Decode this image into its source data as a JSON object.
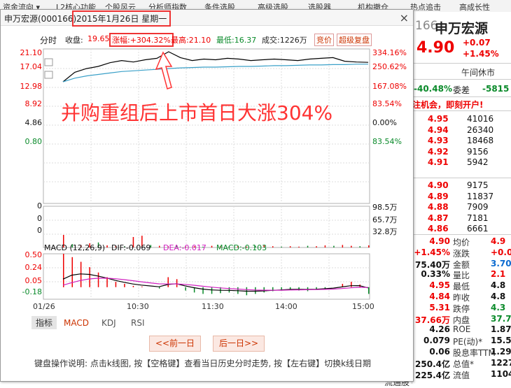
{
  "background_menu": [
    "资金流向 ▾",
    "L2核心功能",
    "个股风云",
    "分析师指数",
    "条件选股",
    "高级选股",
    "选股器",
    "机构撤仓",
    "热点追击",
    "高成长性"
  ],
  "quote_panel": {
    "code": "166",
    "name": "申万宏源",
    "price": "4.90",
    "change": "+0.07",
    "change_pct": "+1.45%",
    "status": "午间休市",
    "ratio_value": "-40.48%",
    "ratio_label": "委差",
    "diff_value": "-5815",
    "promo": "注机会，即刻开户!",
    "sell_levels": [
      [
        "4.95",
        "41016"
      ],
      [
        "4.94",
        "26340"
      ],
      [
        "4.93",
        "18468"
      ],
      [
        "4.92",
        "9156"
      ],
      [
        "4.91",
        "5942"
      ]
    ],
    "buy_levels": [
      [
        "4.90",
        "9175"
      ],
      [
        "4.89",
        "11837"
      ],
      [
        "4.88",
        "7909"
      ],
      [
        "4.87",
        "7181"
      ],
      [
        "4.86",
        "6661"
      ]
    ],
    "stats": [
      [
        "4.90",
        "均价",
        "4.9"
      ],
      [
        "+1.45%",
        "涨跌",
        "+0.0"
      ],
      [
        "75.40万",
        "金额",
        "3.70"
      ],
      [
        "0.33%",
        "量比",
        "2.1"
      ],
      [
        "4.95",
        "最低",
        "4.8"
      ],
      [
        "4.84",
        "昨收",
        "4.8"
      ],
      [
        "5.31",
        "跌停",
        "4.3"
      ],
      [
        "37.66万",
        "内盘",
        "37.74"
      ],
      [
        "4.26",
        "ROE",
        "1.87"
      ],
      [
        "0.079",
        "PE(动)*",
        "15.5"
      ],
      [
        "0.06",
        "股息率TTM",
        "1.29"
      ],
      [
        "250.4亿",
        "总值*",
        "1227"
      ],
      [
        "225.4亿",
        "流值",
        "1104"
      ]
    ],
    "bottom_label": "流通股"
  },
  "dialog": {
    "title": "申万宏源(000166)",
    "date": "2015年1月26日  星期一",
    "close": "×",
    "info": {
      "label": "分时",
      "close_label": "收盘:",
      "close_value": "19.65",
      "change": "涨幅:+304.32%",
      "high": "最高:21.10",
      "low": "最低:16.37",
      "volume": "成交:1226万",
      "btn_bid": "竞价",
      "btn_super": "超级复盘"
    },
    "price_axis_left": [
      "21.10",
      "17.04",
      "12.98",
      "8.92",
      "4.86",
      "0.80"
    ],
    "price_axis_right": [
      "334.16%",
      "250.62%",
      "167.08%",
      "83.54%",
      "0.00%",
      "83.54%"
    ],
    "vol_axis_left": [
      "0",
      "0",
      "0"
    ],
    "vol_axis_right": [
      "98.5万",
      "65.7万",
      "32.8万"
    ],
    "macd_header": {
      "params": "MACD (12,26,9)",
      "dif": "DIF:-0.069",
      "dea": "DEA:-0.017",
      "macd": "MACD:-0.103"
    },
    "macd_axis_left": [
      "0.50",
      "0.24",
      "0.05",
      "-0.18"
    ],
    "time_axis": [
      "01/26",
      "10:30",
      "11:30",
      "14:00",
      "15:00"
    ],
    "tabs": [
      "指标",
      "MACD",
      "KDJ",
      "RSI"
    ],
    "prev_button": "<<前一日",
    "next_button": "后一日>>",
    "help": "键盘操作说明: 点击k线图, 按【空格键】查看当日历史分时走势, 按【左右键】切换k线日期",
    "annotation": "并购重组后上市首日大涨304%"
  },
  "colors": {
    "red": "#e00000",
    "green": "#0a8a2a",
    "price_line": "#000000",
    "avg_line": "#3aa0c8",
    "dif": "#000000",
    "dea": "#d020c0",
    "annotation": "#f33333"
  },
  "chart_data": [
    {
      "type": "line",
      "series": [
        {
          "name": "",
          "values": [
            17.0,
            18.3,
            18.8,
            19.1,
            19.6,
            19.9,
            19.7,
            20.0,
            20.2,
            21.1,
            20.3,
            19.9,
            20.1,
            20.0,
            20.2,
            20.1,
            19.9,
            20.0,
            20.1,
            20.0,
            19.9,
            20.1,
            20.2,
            20.3,
            19.8,
            19.7,
            19.65
          ]
        },
        {
          "name": "",
          "values": [
            17.0,
            17.5,
            17.8,
            18.0,
            18.2,
            18.4,
            18.5,
            18.6,
            18.7,
            18.8,
            18.9,
            18.95,
            19.0,
            19.0,
            19.05,
            19.1,
            19.1,
            19.15,
            19.2,
            19.2,
            19.25,
            19.3,
            19.3,
            19.35,
            19.35,
            19.4,
            19.4
          ]
        }
      ],
      "ylim": [
        0.8,
        21.1
      ]
    },
    {
      "type": "bar",
      "values": [
        30,
        8,
        6,
        10,
        12,
        5,
        4,
        3,
        25,
        28,
        6,
        4,
        3,
        5,
        2,
        3,
        2,
        4,
        3,
        2,
        3,
        2,
        4,
        5,
        3,
        2,
        3,
        2,
        4,
        3,
        5,
        4,
        6,
        4,
        3,
        5
      ],
      "ylim": [
        0,
        98.5
      ]
    },
    {
      "type": "bar",
      "values": [
        0.5,
        0.45,
        0.38,
        0.3,
        0.22,
        0.15,
        0.08,
        0.05,
        0.02,
        0.01,
        0.0,
        -0.02,
        0.15,
        0.12,
        -0.05,
        -0.08,
        -0.1,
        -0.1,
        -0.09,
        -0.08,
        -0.1,
        -0.12,
        -0.1,
        -0.08,
        -0.06,
        -0.05,
        -0.04,
        -0.05,
        -0.06,
        -0.04,
        -0.02,
        0.0,
        0.05,
        0.08,
        0.04,
        -0.1
      ],
      "ylim": [
        -0.18,
        0.5
      ]
    }
  ]
}
